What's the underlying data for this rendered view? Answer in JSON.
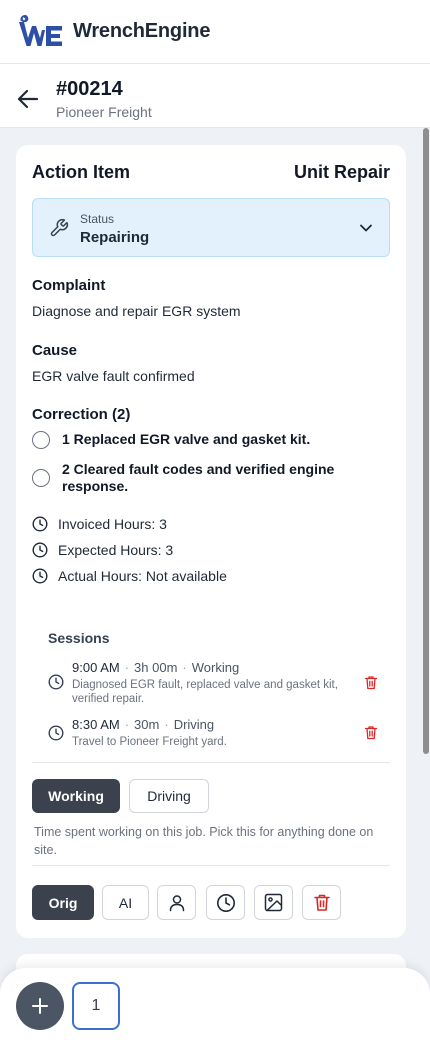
{
  "app": {
    "brand_name": "WrenchEngine",
    "logo_text": "WE",
    "brand_color": "#2d4fa8"
  },
  "job": {
    "number": "#00214",
    "customer": "Pioneer Freight"
  },
  "action_item": {
    "title": "Action Item",
    "type": "Unit Repair",
    "status": {
      "label": "Status",
      "value": "Repairing",
      "icon": "wrench-icon"
    },
    "complaint": {
      "heading": "Complaint",
      "text": "Diagnose and repair EGR system"
    },
    "cause": {
      "heading": "Cause",
      "text": "EGR valve fault confirmed"
    },
    "correction": {
      "heading": "Correction (2)",
      "items": [
        {
          "text": "1 Replaced EGR valve and gasket kit.",
          "checked": false
        },
        {
          "text": "2 Cleared fault codes and verified engine response.",
          "checked": false
        }
      ]
    },
    "hours": {
      "invoiced": "Invoiced Hours: 3",
      "expected": "Expected Hours: 3",
      "actual": "Actual Hours: Not available"
    },
    "sessions": {
      "heading": "Sessions",
      "items": [
        {
          "time": "9:00 AM",
          "duration": "3h 00m",
          "mode": "Working",
          "note": "Diagnosed EGR fault, replaced valve and gasket kit, verified repair."
        },
        {
          "time": "8:30 AM",
          "duration": "30m",
          "mode": "Driving",
          "note": "Travel to Pioneer Freight yard."
        }
      ]
    },
    "modes": {
      "working": "Working",
      "driving": "Driving",
      "selected": "Working"
    },
    "mode_description": "Time spent working on this job. Pick this for anything done on site.",
    "tools": {
      "orig": "Orig",
      "ai": "AI",
      "icons": [
        "person-icon",
        "clock-icon",
        "image-icon",
        "trash-icon"
      ]
    }
  },
  "bottom": {
    "count": "1"
  },
  "colors": {
    "status_bg": "#e3f1fd",
    "primary_dark": "#3b414d",
    "danger": "#dc2626",
    "count_border": "#3b6fd4"
  }
}
